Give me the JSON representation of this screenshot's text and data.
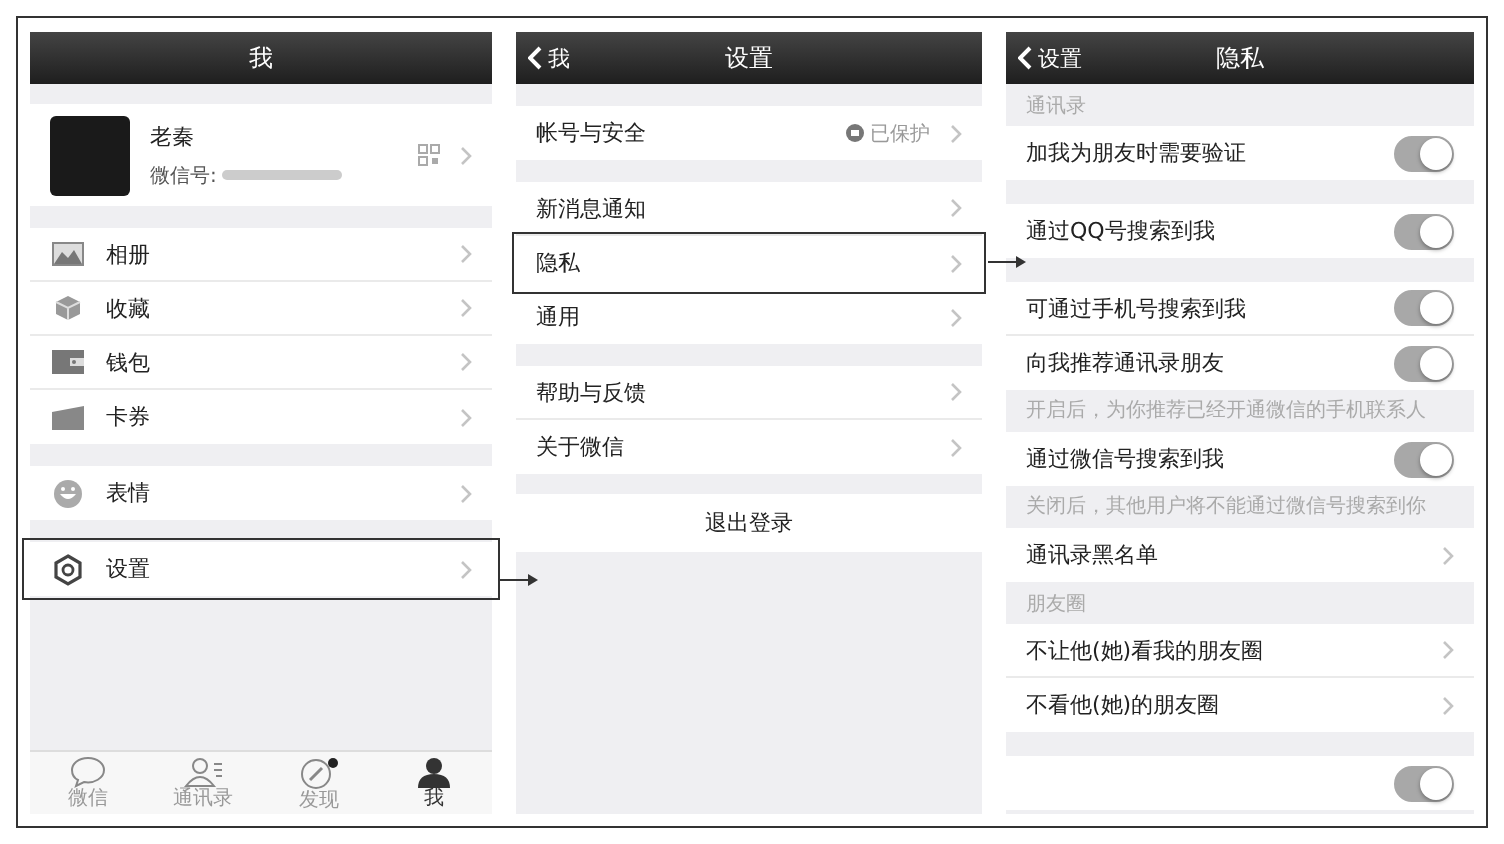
{
  "me": {
    "title": "我",
    "profile": {
      "name": "老秦",
      "id_label": "微信号:"
    },
    "groups": [
      [
        {
          "label": "相册",
          "highlighted": false
        },
        {
          "label": "收藏",
          "highlighted": false
        },
        {
          "label": "钱包",
          "highlighted": false
        },
        {
          "label": "卡券",
          "highlighted": false
        }
      ],
      [
        {
          "label": "表情",
          "highlighted": false
        }
      ],
      [
        {
          "label": "设置",
          "highlighted": true
        }
      ]
    ],
    "tabs": [
      {
        "label": "微信",
        "selected": false
      },
      {
        "label": "通讯录",
        "selected": false
      },
      {
        "label": "发现",
        "selected": false,
        "badge": true
      },
      {
        "label": "我",
        "selected": true
      }
    ]
  },
  "settings": {
    "back": "我",
    "title": "设置",
    "groups": [
      [
        {
          "label": "帐号与安全",
          "status": "已保护",
          "highlighted": false
        }
      ],
      [
        {
          "label": "新消息通知",
          "highlighted": false
        },
        {
          "label": "隐私",
          "highlighted": true
        },
        {
          "label": "通用",
          "highlighted": false
        }
      ],
      [
        {
          "label": "帮助与反馈",
          "highlighted": false
        },
        {
          "label": "关于微信",
          "highlighted": false
        }
      ]
    ],
    "logout": "退出登录"
  },
  "privacy": {
    "back": "设置",
    "title": "隐私",
    "groups": [
      {
        "header": "通讯录",
        "rows": [
          {
            "kind": "toggle",
            "label": "加我为朋友时需要验证",
            "on": true
          }
        ]
      },
      {
        "rows": [
          {
            "kind": "toggle",
            "label": "通过QQ号搜索到我",
            "on": true
          }
        ]
      },
      {
        "rows": [
          {
            "kind": "toggle",
            "label": "可通过手机号搜索到我",
            "on": true
          },
          {
            "kind": "toggle",
            "label": "向我推荐通讯录朋友",
            "on": true
          }
        ],
        "note": "开启后，为你推荐已经开通微信的手机联系人"
      },
      {
        "rows": [
          {
            "kind": "toggle",
            "label": "通过微信号搜索到我",
            "on": true
          }
        ],
        "note": "关闭后，其他用户将不能通过微信号搜索到你"
      },
      {
        "rows": [
          {
            "kind": "link",
            "label": "通讯录黑名单"
          }
        ]
      },
      {
        "header": "朋友圈",
        "rows": [
          {
            "kind": "link",
            "label": "不让他(她)看我的朋友圈"
          },
          {
            "kind": "link",
            "label": "不看他(她)的朋友圈"
          }
        ]
      },
      {
        "rows": [
          {
            "kind": "toggle",
            "on": true
          }
        ]
      }
    ]
  }
}
